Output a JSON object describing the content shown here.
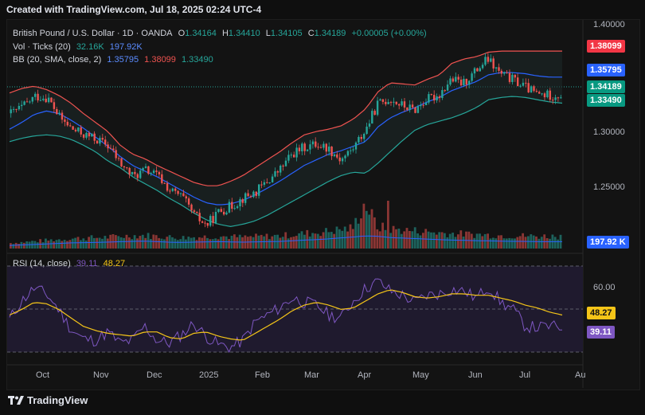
{
  "caption": "Created with TradingView.com, Jul 18, 2025 02:24 UTC-4",
  "legend": {
    "symbol": "British Pound / U.S. Dollar · 1D · OANDA",
    "o_label": "O",
    "o_value": "1.34164",
    "h_label": "H",
    "h_value": "1.34410",
    "l_label": "L",
    "l_value": "1.34105",
    "c_label": "C",
    "c_value": "1.34189",
    "change": "+0.00005 (+0.00%)",
    "vol_label": "Vol · Ticks (20)",
    "vol_value": "32.16K",
    "vol_ma": "197.92K",
    "bb_label": "BB (20, SMA, close, 2)",
    "bb_basis": "1.35795",
    "bb_upper": "1.38099",
    "bb_lower": "1.33490",
    "rsi_label": "RSI (14, close)",
    "rsi_value": "39.11",
    "rsi_ma": "48.27"
  },
  "tags": {
    "bb_upper": "1.38099",
    "bb_basis": "1.35795",
    "price": "1.34189",
    "bb_lower": "1.33490",
    "volume": "197.92 K",
    "rsi_ma": "48.27",
    "rsi": "39.11"
  },
  "colors": {
    "up": "#26a69a",
    "down": "#ef5350",
    "basis": "#2962ff",
    "upper": "#ef5350",
    "lower": "#26a69a",
    "rsi": "#7e57c2",
    "rsi_ma": "#f5c518"
  },
  "price_axis_labels": [
    "1.40000",
    "1.35000",
    "1.30000",
    "1.25000"
  ],
  "rsi_axis_labels": [
    "60.00"
  ],
  "time_axis_labels": [
    "Oct",
    "Nov",
    "Dec",
    "2025",
    "Feb",
    "Mar",
    "Apr",
    "May",
    "Jun",
    "Jul",
    "Au"
  ],
  "brand": "TradingView",
  "chart_data": {
    "type": "candlestick",
    "title": "British Pound / U.S. Dollar · 1D · OANDA",
    "price_range": [
      1.215,
      1.405
    ],
    "rsi_range": [
      20,
      85
    ],
    "grid": false,
    "x_months": [
      "Oct",
      "Nov",
      "Dec",
      "2025",
      "Feb",
      "Mar",
      "Apr",
      "May",
      "Jun",
      "Jul",
      "Au"
    ],
    "close_path": [
      1.326,
      1.332,
      1.341,
      1.34,
      1.322,
      1.312,
      1.307,
      1.303,
      1.297,
      1.281,
      1.27,
      1.276,
      1.271,
      1.258,
      1.252,
      1.236,
      1.227,
      1.239,
      1.244,
      1.251,
      1.256,
      1.266,
      1.276,
      1.29,
      1.296,
      1.299,
      1.295,
      1.285,
      1.295,
      1.311,
      1.334,
      1.339,
      1.333,
      1.329,
      1.338,
      1.342,
      1.356,
      1.352,
      1.363,
      1.374,
      1.361,
      1.356,
      1.35,
      1.343,
      1.342,
      1.342
    ],
    "bb_upper_path": [
      1.344,
      1.348,
      1.35,
      1.347,
      1.342,
      1.335,
      1.326,
      1.318,
      1.31,
      1.298,
      1.29,
      1.286,
      1.28,
      1.275,
      1.27,
      1.265,
      1.262,
      1.262,
      1.266,
      1.271,
      1.278,
      1.285,
      1.292,
      1.3,
      1.307,
      1.31,
      1.312,
      1.315,
      1.321,
      1.33,
      1.345,
      1.353,
      1.352,
      1.351,
      1.356,
      1.36,
      1.37,
      1.374,
      1.376,
      1.38,
      1.381,
      1.381,
      1.381,
      1.381,
      1.381,
      1.381
    ],
    "bb_basis_path": [
      1.312,
      1.318,
      1.325,
      1.328,
      1.326,
      1.32,
      1.313,
      1.305,
      1.297,
      1.288,
      1.28,
      1.275,
      1.27,
      1.264,
      1.258,
      1.252,
      1.247,
      1.245,
      1.246,
      1.249,
      1.254,
      1.26,
      1.266,
      1.273,
      1.28,
      1.285,
      1.29,
      1.293,
      1.297,
      1.301,
      1.314,
      1.322,
      1.327,
      1.331,
      1.336,
      1.34,
      1.346,
      1.35,
      1.354,
      1.36,
      1.362,
      1.362,
      1.361,
      1.359,
      1.358,
      1.358
    ],
    "bb_lower_path": [
      1.301,
      1.304,
      1.306,
      1.307,
      1.306,
      1.303,
      1.298,
      1.292,
      1.284,
      1.278,
      1.27,
      1.264,
      1.258,
      1.251,
      1.245,
      1.238,
      1.232,
      1.228,
      1.226,
      1.228,
      1.231,
      1.236,
      1.242,
      1.248,
      1.254,
      1.26,
      1.266,
      1.271,
      1.274,
      1.273,
      1.282,
      1.292,
      1.302,
      1.311,
      1.316,
      1.319,
      1.322,
      1.326,
      1.331,
      1.338,
      1.34,
      1.341,
      1.34,
      1.338,
      1.336,
      1.335
    ],
    "rsi_path": [
      45,
      58,
      67,
      63,
      52,
      38,
      31,
      30,
      36,
      28,
      30,
      40,
      30,
      28,
      34,
      42,
      33,
      27,
      25,
      30,
      43,
      48,
      53,
      60,
      57,
      55,
      48,
      46,
      58,
      67,
      72,
      65,
      62,
      57,
      62,
      63,
      66,
      65,
      60,
      68,
      57,
      52,
      40,
      39,
      40,
      39
    ],
    "rsi_ma_path": [
      48,
      52,
      57,
      56,
      52,
      46,
      40,
      37,
      35,
      34,
      33,
      36,
      36,
      32,
      31,
      35,
      36,
      33,
      31,
      30,
      35,
      40,
      45,
      51,
      55,
      57,
      55,
      52,
      53,
      58,
      63,
      66,
      64,
      61,
      60,
      61,
      63,
      63,
      62,
      62,
      60,
      58,
      55,
      53,
      50,
      48
    ],
    "volume_path": [
      0.12,
      0.14,
      0.16,
      0.18,
      0.2,
      0.22,
      0.23,
      0.24,
      0.25,
      0.27,
      0.28,
      0.29,
      0.27,
      0.25,
      0.24,
      0.25,
      0.26,
      0.27,
      0.26,
      0.25,
      0.26,
      0.27,
      0.28,
      0.3,
      0.33,
      0.35,
      0.38,
      0.42,
      0.45,
      1.0,
      0.48,
      0.43,
      0.41,
      0.39,
      0.37,
      0.35,
      0.33,
      0.32,
      0.31,
      0.3,
      0.29,
      0.28,
      0.28,
      0.27,
      0.27,
      0.27
    ],
    "series": [
      {
        "name": "Vol · Ticks (20)"
      },
      {
        "name": "BB (20, SMA, close, 2)"
      },
      {
        "name": "RSI (14, close)"
      }
    ]
  }
}
